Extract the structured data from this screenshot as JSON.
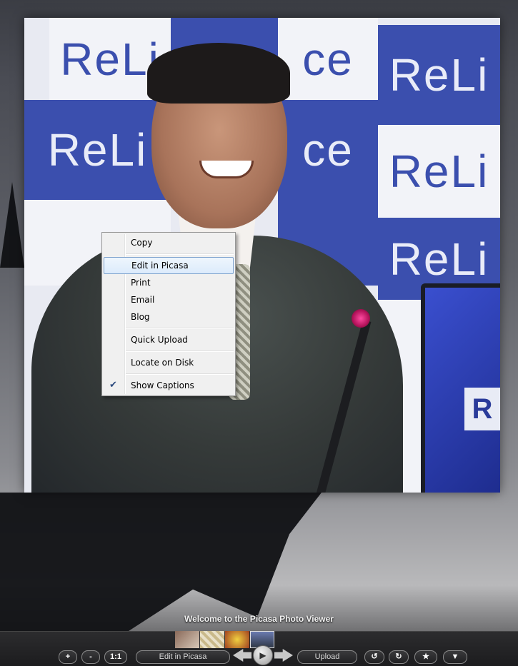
{
  "viewer": {
    "welcome_text": "Welcome to the Picasa Photo Viewer"
  },
  "photo": {
    "backdrop_brand_text": "ReLi",
    "backdrop_brand_text_2": "ce",
    "laptop_text": "R",
    "brand_blue": "#3b4fae"
  },
  "context_menu": {
    "items": [
      {
        "label": "Copy",
        "highlighted": false,
        "checked": false
      },
      {
        "label": "Edit in Picasa",
        "highlighted": true,
        "checked": false
      },
      {
        "label": "Print",
        "highlighted": false,
        "checked": false
      },
      {
        "label": "Email",
        "highlighted": false,
        "checked": false
      },
      {
        "label": "Blog",
        "highlighted": false,
        "checked": false
      },
      {
        "label": "Quick Upload",
        "highlighted": false,
        "checked": false
      },
      {
        "label": "Locate on Disk",
        "highlighted": false,
        "checked": false
      },
      {
        "label": "Show Captions",
        "highlighted": false,
        "checked": true
      }
    ],
    "check_icon": "checkmark-icon"
  },
  "toolbar": {
    "zoom_in": "+",
    "zoom_out": "-",
    "actual_size": "1:1",
    "edit": "Edit in Picasa",
    "upload": "Upload",
    "rotate_left": "↺",
    "rotate_right": "↻",
    "star": "★",
    "more": "▼",
    "play": "▶"
  }
}
